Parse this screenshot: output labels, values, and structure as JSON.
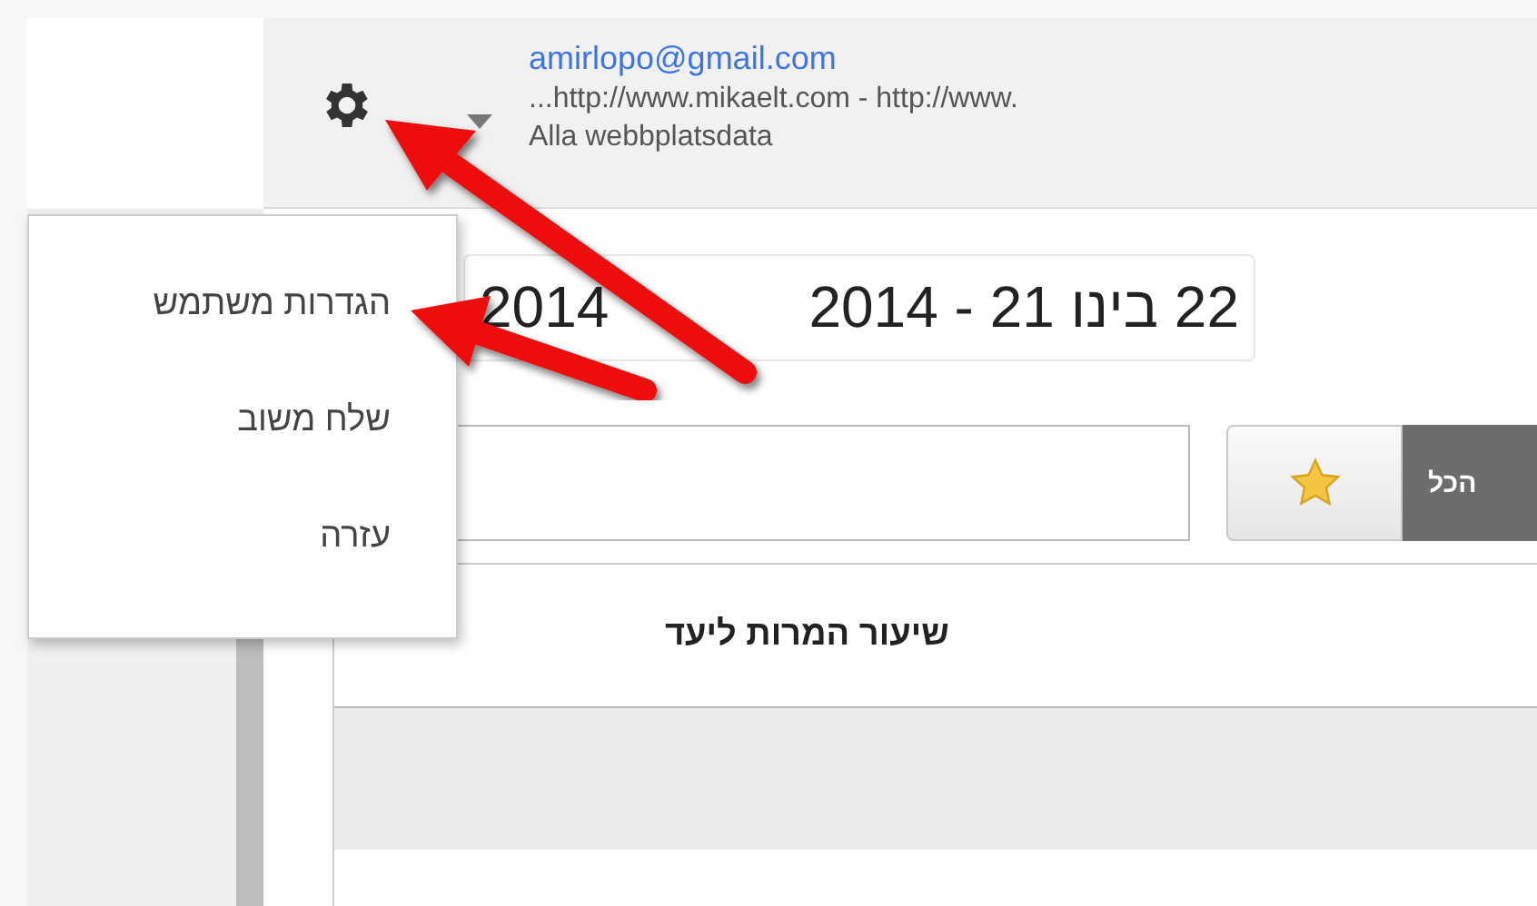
{
  "header": {
    "email": "amirlopo@gmail.com",
    "property": "...http://www.mikaelt.com - http://www.",
    "view": "Alla webbplatsdata"
  },
  "menu": {
    "items": [
      {
        "label": "הגדרות משתמש"
      },
      {
        "label": "שלח משוב"
      },
      {
        "label": "עזרה"
      }
    ]
  },
  "date_range": {
    "end": "22 בינו 21 - 2014",
    "start": "2014"
  },
  "segment_button": "הכל",
  "panel": {
    "title": "שיעור המרות ליעד"
  }
}
